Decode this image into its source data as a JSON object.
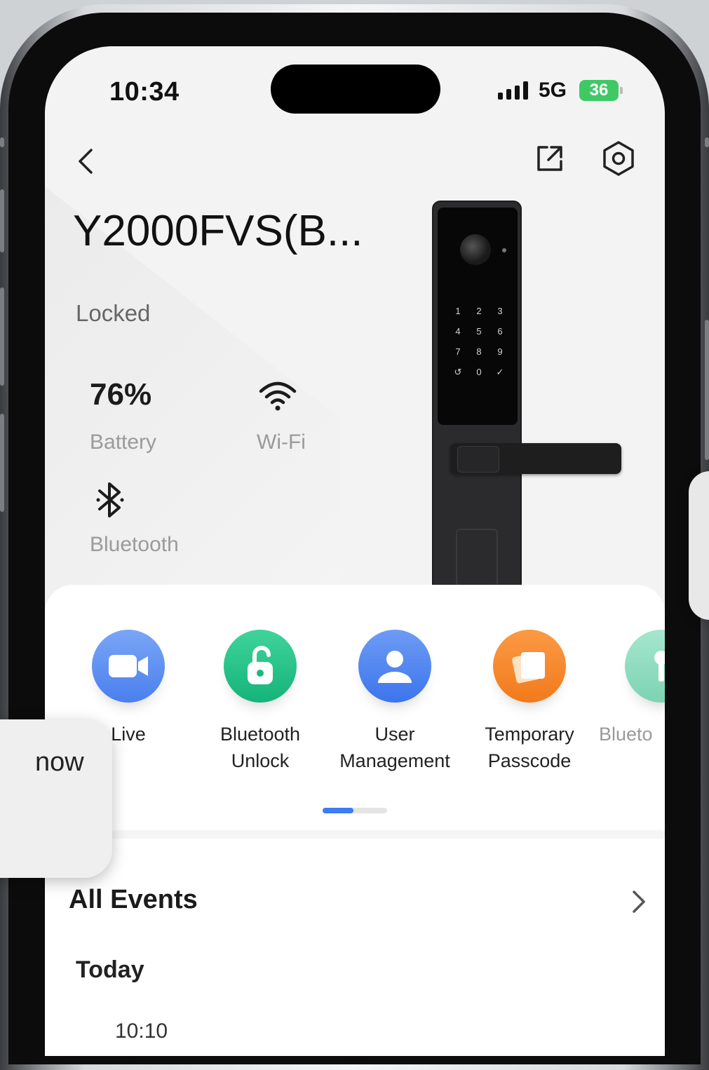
{
  "status_bar": {
    "time": "10:34",
    "network": "5G",
    "battery": "36"
  },
  "device": {
    "name": "Y2000FVS(B...",
    "lock_state": "Locked"
  },
  "metrics": {
    "battery_value": "76%",
    "battery_label": "Battery",
    "wifi_label": "Wi-Fi",
    "bluetooth_label": "Bluetooth"
  },
  "lock_keypad": [
    "1",
    "2",
    "3",
    "4",
    "5",
    "6",
    "7",
    "8",
    "9",
    "↺",
    "0",
    "✓"
  ],
  "actions": [
    {
      "label": "Live",
      "icon": "video-camera-icon",
      "color": "#5b8ff2"
    },
    {
      "label": "Bluetooth\nUnlock",
      "icon": "unlock-icon",
      "color": "#22c28a"
    },
    {
      "label": "User\nManagement",
      "icon": "user-icon",
      "color": "#4f86ef"
    },
    {
      "label": "Temporary\nPasscode",
      "icon": "passcode-cards-icon",
      "color": "#f58a2c"
    },
    {
      "label": "Blueto",
      "icon": "key-icon",
      "color": "#8fdcc0"
    }
  ],
  "events": {
    "title": "All Events",
    "today": "Today",
    "first_time": "10:10"
  },
  "toast": {
    "text": "now"
  },
  "colors": {
    "accent": "#3c7df2",
    "battery_green": "#3fc965"
  }
}
